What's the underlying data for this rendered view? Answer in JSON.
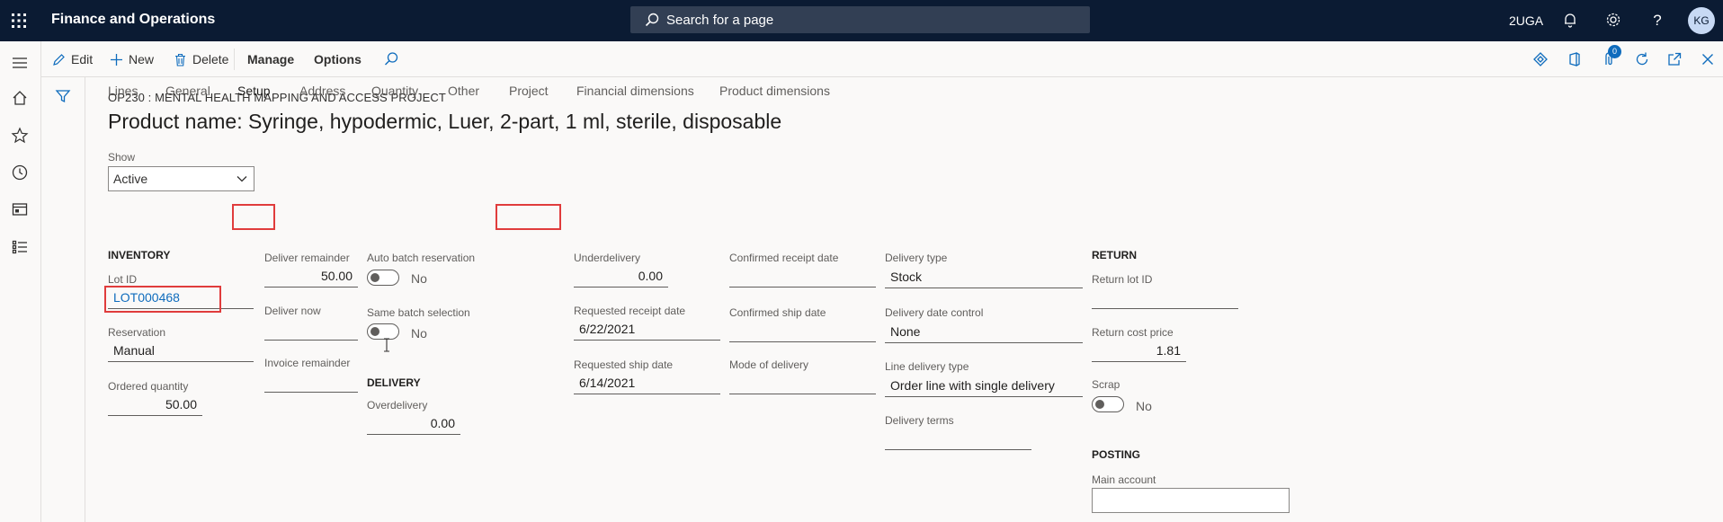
{
  "topbar": {
    "app_title": "Finance and Operations",
    "search_placeholder": "Search for a page",
    "company": "2UGA",
    "avatar_initials": "KG"
  },
  "actions": {
    "edit": "Edit",
    "new": "New",
    "delete": "Delete",
    "manage": "Manage",
    "options": "Options",
    "attachments_count": "0"
  },
  "header": {
    "caption": "OP230 : MENTAL HEALTH MAPPING AND ACCESS PROJECT",
    "title": "Product name: Syringe, hypodermic, Luer, 2-part, 1 ml, sterile, disposable",
    "show_label": "Show",
    "show_value": "Active"
  },
  "tabs": [
    "Lines",
    "General",
    "Setup",
    "Address",
    "Quantity",
    "Other",
    "Project",
    "Financial dimensions",
    "Product dimensions"
  ],
  "inventory": {
    "heading": "INVENTORY",
    "lot_id_label": "Lot ID",
    "lot_id": "LOT000468",
    "reservation_label": "Reservation",
    "reservation": "Manual",
    "ordered_qty_label": "Ordered quantity",
    "ordered_qty": "50.00"
  },
  "deliver": {
    "remainder_label": "Deliver remainder",
    "remainder": "50.00",
    "now_label": "Deliver now",
    "now": "",
    "invoice_label": "Invoice remainder",
    "invoice": ""
  },
  "batch": {
    "auto_label": "Auto batch reservation",
    "auto_value": "No",
    "same_label": "Same batch selection",
    "same_value": "No"
  },
  "delivery": {
    "heading": "DELIVERY",
    "overdelivery_label": "Overdelivery",
    "overdelivery": "0.00",
    "underdelivery_label": "Underdelivery",
    "underdelivery": "0.00",
    "req_receipt_label": "Requested receipt date",
    "req_receipt": "6/22/2021",
    "req_ship_label": "Requested ship date",
    "req_ship": "6/14/2021",
    "conf_receipt_label": "Confirmed receipt date",
    "conf_receipt": "",
    "conf_ship_label": "Confirmed ship date",
    "conf_ship": "",
    "mode_label": "Mode of delivery",
    "mode": "",
    "type_label": "Delivery type",
    "type": "Stock",
    "date_control_label": "Delivery date control",
    "date_control": "None",
    "line_type_label": "Line delivery type",
    "line_type": "Order line with single delivery",
    "terms_label": "Delivery terms",
    "terms": ""
  },
  "return": {
    "heading": "RETURN",
    "lot_label": "Return lot ID",
    "lot": "",
    "cost_label": "Return cost price",
    "cost": "1.81",
    "scrap_label": "Scrap",
    "scrap_value": "No"
  },
  "posting": {
    "heading": "POSTING",
    "main_account_label": "Main account",
    "main_account": ""
  },
  "colors": {
    "topbar": "#0b1b33",
    "highlight": "#e03c3c",
    "link": "#0f6cbd"
  }
}
